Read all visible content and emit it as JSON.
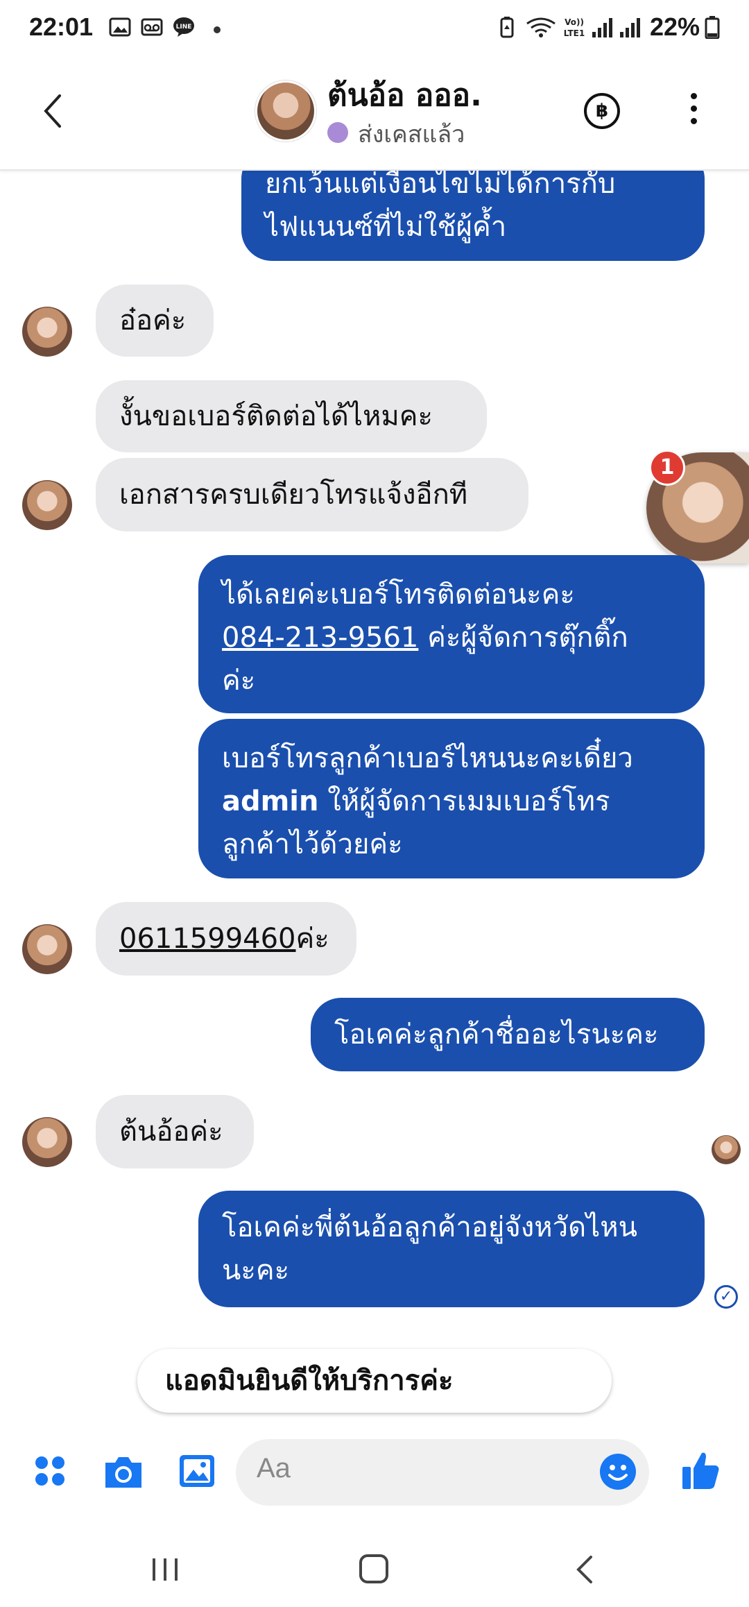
{
  "status_bar": {
    "time": "22:01",
    "battery": "22%",
    "icons": [
      "gallery-icon",
      "voicemail-icon",
      "line-app-icon",
      "battery-saver-icon",
      "wifi-icon",
      "volte-icon",
      "signal-icon"
    ]
  },
  "header": {
    "contact_name": "ต้นอ้อ อออ.",
    "status_text": "ส่งเคสแล้ว",
    "status_color": "#a98ad6",
    "currency_symbol": "฿"
  },
  "messages": [
    {
      "dir": "out",
      "lines": [
        "ยกเว้นแต่เงื่อนไขไม่ได้การกับ",
        "ไฟแนนซ์ที่ไม่ใช้ผู้ค้ำ"
      ]
    },
    {
      "dir": "in",
      "text": "อ๋อค่ะ"
    },
    {
      "dir": "in",
      "text": "งั้นขอเบอร์ติดต่อได้ไหมคะ"
    },
    {
      "dir": "in",
      "text": "เอกสารครบเดียวโทรแจ้งอีกที"
    },
    {
      "dir": "out",
      "line1": "ได้เลยค่ะเบอร์โทรติดต่อนะคะ",
      "phone": "084-213-9561",
      "line2_rest": " ค่ะผู้จัดการตุ๊กติ๊ก",
      "line3": "ค่ะ"
    },
    {
      "dir": "out",
      "line1": "เบอร์โทรลูกค้าเบอร์ไหนนะคะเดี๋ยว",
      "bold": "admin",
      "line2_rest": " ให้ผู้จัดการเมมเบอร์โทร",
      "line3": "ลูกค้าไว้ด้วยค่ะ"
    },
    {
      "dir": "in",
      "phone": "0611599460",
      "suffix": "ค่ะ"
    },
    {
      "dir": "out",
      "text": "โอเคค่ะลูกค้าชื่ออะไรนะคะ"
    },
    {
      "dir": "in",
      "text": "ต้นอ้อค่ะ"
    },
    {
      "dir": "out",
      "lines": [
        "โอเคค่ะพี่ต้นอ้อลูกค้าอยู่จังหวัดไหน",
        "นะคะ"
      ]
    }
  ],
  "chat_head": {
    "badge": "1"
  },
  "quick_reply": "แอดมินยินดีให้บริการค่ะ",
  "composer": {
    "placeholder": "Aa",
    "accent": "#1877f2",
    "bubble_color": "#1a4fae"
  }
}
